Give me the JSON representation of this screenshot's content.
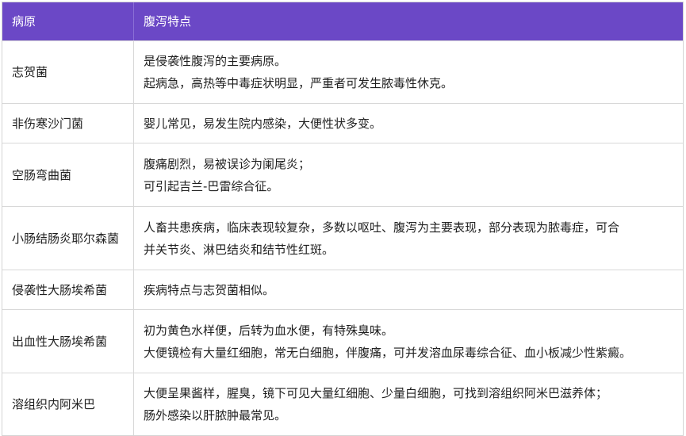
{
  "table": {
    "headers": [
      "病原",
      "腹泻特点"
    ],
    "rows": [
      {
        "pathogen": "志贺菌",
        "lines": [
          "是侵袭性腹泻的主要病原。",
          "起病急，高热等中毒症状明显，严重者可发生脓毒性休克。"
        ]
      },
      {
        "pathogen": "非伤寒沙门菌",
        "lines": [
          "婴儿常见，易发生院内感染，大便性状多变。"
        ]
      },
      {
        "pathogen": "空肠弯曲菌",
        "lines": [
          "腹痛剧烈，易被误诊为阑尾炎；",
          "可引起吉兰-巴雷综合征。"
        ]
      },
      {
        "pathogen": "小肠结肠炎耶尔森菌",
        "lines": [
          "人畜共患疾病，临床表现较复杂，多数以呕吐、腹泻为主要表现，部分表现为脓毒症，可合",
          "并关节炎、淋巴结炎和结节性红斑。"
        ]
      },
      {
        "pathogen": "侵袭性大肠埃希菌",
        "lines": [
          "疾病特点与志贺菌相似。"
        ]
      },
      {
        "pathogen": "出血性大肠埃希菌",
        "lines": [
          "初为黄色水样便，后转为血水便，有特殊臭味。",
          "大便镜检有大量红细胞，常无白细胞，伴腹痛，可并发溶血尿毒综合征、血小板减少性紫癜。"
        ]
      },
      {
        "pathogen": "溶组织内阿米巴",
        "lines": [
          "大便呈果酱样，腥臭，镜下可见大量红细胞、少量白细胞，可找到溶组织阿米巴滋养体；",
          "肠外感染以肝脓肿最常见。"
        ]
      }
    ]
  }
}
